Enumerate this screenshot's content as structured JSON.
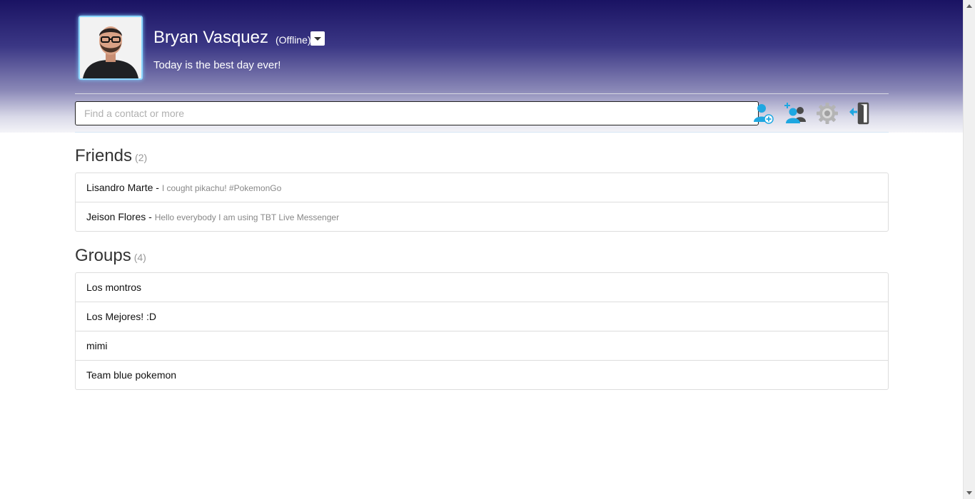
{
  "profile": {
    "name": "Bryan Vasquez",
    "status": "(Offline)",
    "motto": "Today is the best day ever!"
  },
  "search": {
    "placeholder": "Find a contact or more"
  },
  "toolbar": {
    "icons": [
      "add-contact-icon",
      "add-group-icon",
      "settings-gear-icon",
      "sign-out-icon"
    ],
    "accent_color": "#1ea7e1"
  },
  "friends": {
    "title": "Friends",
    "count": "(2)",
    "items": [
      {
        "name": "Lisandro Marte",
        "separator": " - ",
        "message": "I cought pikachu! #PokemonGo"
      },
      {
        "name": "Jeison Flores",
        "separator": " - ",
        "message": "Hello everybody I am using TBT Live Messenger"
      }
    ]
  },
  "groups": {
    "title": "Groups",
    "count": "(4)",
    "items": [
      {
        "name": "Los montros"
      },
      {
        "name": "Los Mejores! :D"
      },
      {
        "name": "mimi"
      },
      {
        "name": "Team blue pokemon"
      }
    ]
  }
}
